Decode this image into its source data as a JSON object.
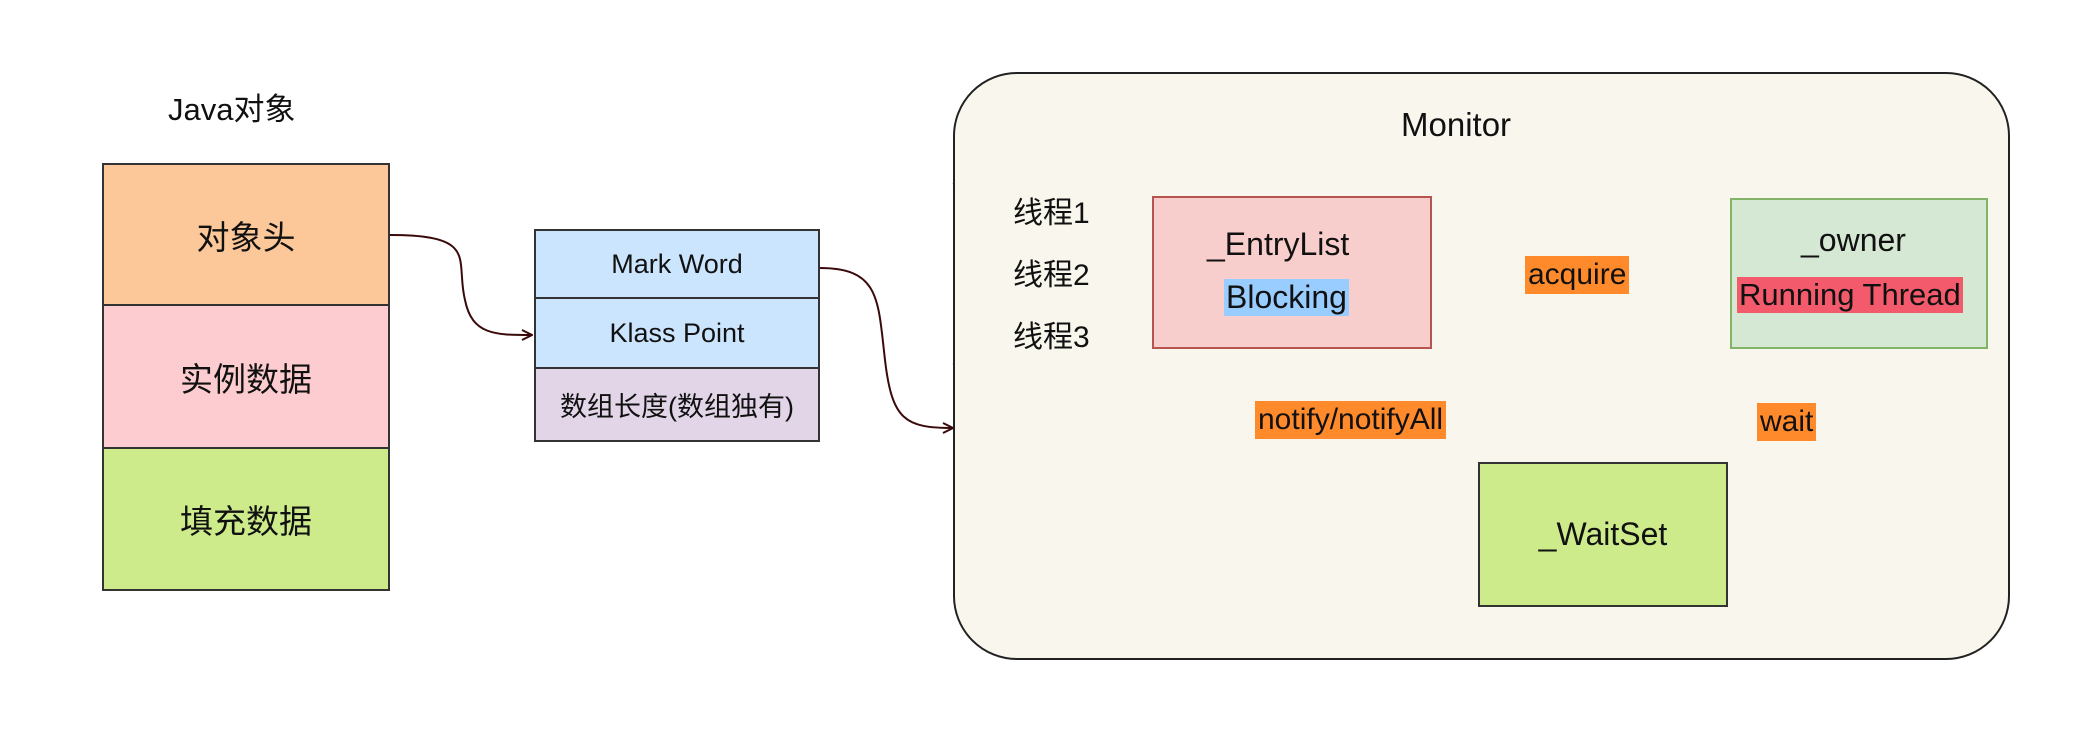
{
  "java_object": {
    "title": "Java对象",
    "parts": [
      "对象头",
      "实例数据",
      "填充数据"
    ],
    "colors": [
      "#fdc899",
      "#fcccd0",
      "#cdeb8b"
    ]
  },
  "header": {
    "rows": [
      "Mark Word",
      "Klass Point",
      "数组长度(数组独有)"
    ],
    "colors": [
      "#cce5ff",
      "#cce5ff",
      "#e1d5e7"
    ]
  },
  "monitor": {
    "title": "Monitor",
    "background": "#f9f7ed",
    "threads": [
      "线程1",
      "线程2",
      "线程3"
    ],
    "entry_list": {
      "name": "_EntryList",
      "state": "Blocking",
      "color": "#f8cecc",
      "state_highlight": "#99ccff"
    },
    "owner": {
      "name": "_owner",
      "state": "Running Thread",
      "color": "#d5e8d4",
      "state_highlight": "#f35b6c"
    },
    "wait_set": {
      "name": "_WaitSet",
      "color": "#cdeb8b"
    },
    "edges": {
      "acquire": "acquire",
      "wait": "wait",
      "notify": "notify/notifyAll"
    },
    "edge_label_color": "#ff8a2b"
  }
}
